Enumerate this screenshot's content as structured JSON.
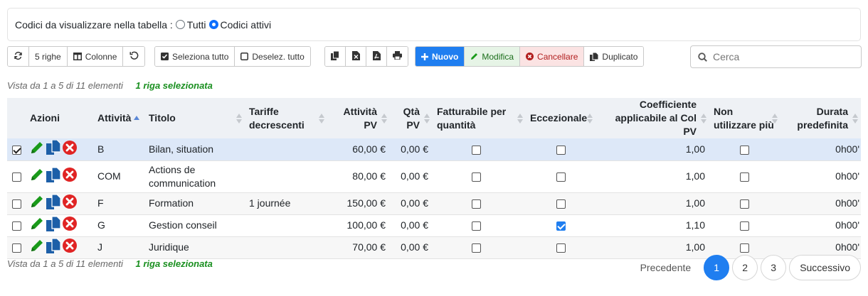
{
  "filter": {
    "label": "Codici da visualizzare nella tabella :",
    "options": [
      {
        "label": "Tutti",
        "checked": false
      },
      {
        "label": "Codici attivi",
        "checked": true
      }
    ]
  },
  "toolbar": {
    "refresh_icon": "refresh-icon",
    "rows_label": "5 righe",
    "columns_label": "Colonne",
    "reset_icon": "undo-icon",
    "select_all_label": "Seleziona tutto",
    "deselect_all_label": "Deselez. tutto",
    "copy_icon": "copy-icon",
    "excel_icon": "excel-icon",
    "pdf_icon": "pdf-icon",
    "print_icon": "print-icon",
    "new_label": "Nuovo",
    "edit_label": "Modifica",
    "delete_label": "Cancellare",
    "duplicate_label": "Duplicato"
  },
  "search": {
    "placeholder": "Cerca"
  },
  "info": {
    "range": "Vista da 1 a 5 di 11 elementi",
    "selected": "1 riga selezionata"
  },
  "table": {
    "headers": {
      "azioni": "Azioni",
      "attivita": "Attività",
      "titolo": "Titolo",
      "tariffe": "Tariffe decrescenti",
      "attivita_pv": "Attività PV",
      "qta_pv": "Qtà PV",
      "fatturabile": "Fatturabile per quantità",
      "eccezionale": "Eccezionale",
      "coefficiente": "Coefficiente applicabile al Col PV",
      "non_utilizzare": "Non utilizzare più",
      "durata": "Durata predefinita"
    },
    "rows": [
      {
        "selected": true,
        "code": "B",
        "title": "Bilan, situation",
        "tariffe": "",
        "attivita_pv": "60,00 €",
        "qta_pv": "0,00 €",
        "fatturabile": false,
        "eccezionale": false,
        "coefficiente": "1,00",
        "non_utilizzare": false,
        "durata": "0h00'"
      },
      {
        "selected": false,
        "code": "COM",
        "title": "Actions de communication",
        "tariffe": "",
        "attivita_pv": "80,00 €",
        "qta_pv": "0,00 €",
        "fatturabile": false,
        "eccezionale": false,
        "coefficiente": "1,00",
        "non_utilizzare": false,
        "durata": "0h00'"
      },
      {
        "selected": false,
        "code": "F",
        "title": "Formation",
        "tariffe": "1 journée",
        "attivita_pv": "150,00 €",
        "qta_pv": "0,00 €",
        "fatturabile": false,
        "eccezionale": false,
        "coefficiente": "1,00",
        "non_utilizzare": false,
        "durata": "0h00'"
      },
      {
        "selected": false,
        "code": "G",
        "title": "Gestion conseil",
        "tariffe": "",
        "attivita_pv": "100,00 €",
        "qta_pv": "0,00 €",
        "fatturabile": false,
        "eccezionale": true,
        "coefficiente": "1,10",
        "non_utilizzare": false,
        "durata": "0h00'"
      },
      {
        "selected": false,
        "code": "J",
        "title": "Juridique",
        "tariffe": "",
        "attivita_pv": "70,00 €",
        "qta_pv": "0,00 €",
        "fatturabile": false,
        "eccezionale": false,
        "coefficiente": "1,00",
        "non_utilizzare": false,
        "durata": "0h00'"
      }
    ]
  },
  "pagination": {
    "prev": "Precedente",
    "pages": [
      "1",
      "2",
      "3"
    ],
    "active": "1",
    "next": "Successivo"
  },
  "colors": {
    "primary": "#1f7ef0",
    "edit_green": "#1a9a1a",
    "dup_blue": "#1d5fa8",
    "delete_red": "#e02424",
    "selected_text": "#198f1f"
  }
}
